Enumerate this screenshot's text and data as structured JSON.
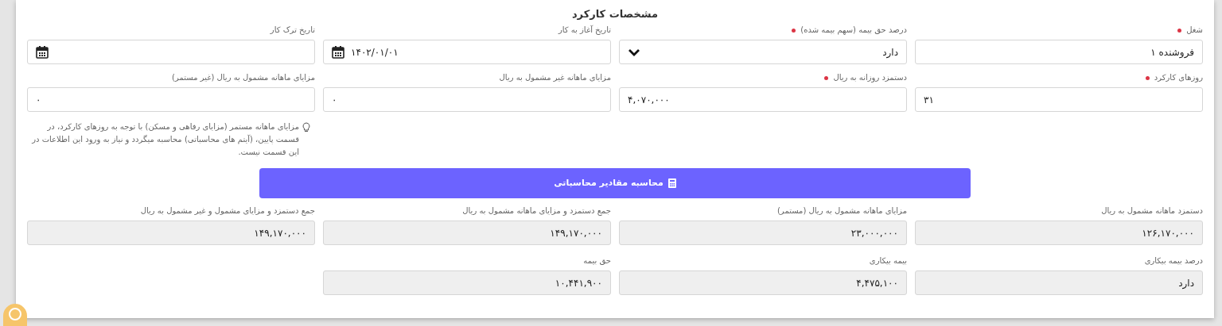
{
  "title": "مشخصات کارکرد",
  "rows": [
    [
      {
        "kind": "text",
        "label": "شغل",
        "required": true,
        "value": "فروشنده ۱"
      },
      {
        "kind": "select",
        "label": "درصد حق بیمه (سهم بیمه شده)",
        "required": true,
        "value": "دارد"
      },
      {
        "kind": "date",
        "label": "تاریخ آغاز به کار",
        "required": false,
        "value": "۱۴۰۲/۰۱/۰۱"
      },
      {
        "kind": "date",
        "label": "تاریخ ترک کار",
        "required": false
      }
    ],
    [
      {
        "kind": "number",
        "label": "روزهای کارکرد",
        "required": true,
        "value": "۳۱"
      },
      {
        "kind": "number",
        "label": "دستمزد روزانه به ریال",
        "required": true,
        "value": "۴,۰۷۰,۰۰۰"
      },
      {
        "kind": "number",
        "label": "مزایای ماهانه غیر مشمول به ریال",
        "required": false,
        "value": "۰"
      },
      {
        "kind": "number",
        "label": "مزایای ماهانه مشمول به ریال (غیر مستمر)",
        "required": false,
        "value": "۰"
      }
    ]
  ],
  "note": "مزایای ماهانه مستمر (مزایای رفاهی و مسکن) با توجه به روزهای کارکرد، در قسمت پایین، (آیتم های محاسباتی) محاسبه میگردد و نیاز به ورود این اطلاعات در این قسمت نیست.",
  "calculate_button": "محاسبه مقادیر محاسباتی",
  "results": [
    [
      {
        "label": "دستمزد ماهانه مشمول به ریال",
        "value": "۱۲۶,۱۷۰,۰۰۰"
      },
      {
        "label": "مزایای ماهانه مشمول به ریال (مستمر)",
        "value": "۲۳,۰۰۰,۰۰۰"
      },
      {
        "label": "جمع دستمزد و مزایای ماهانه مشمول به ریال",
        "value": "۱۴۹,۱۷۰,۰۰۰"
      },
      {
        "label": "جمع دستمزد و مزایای مشمول و غیر مشمول به ریال",
        "value": "۱۴۹,۱۷۰,۰۰۰"
      }
    ],
    [
      {
        "label": "درصد بیمه بیکاری",
        "value": "دارد"
      },
      {
        "label": "بیمه بیکاری",
        "value": "۴,۴۷۵,۱۰۰"
      },
      {
        "label": "حق بیمه",
        "value": "۱۰,۴۴۱,۹۰۰"
      }
    ]
  ]
}
